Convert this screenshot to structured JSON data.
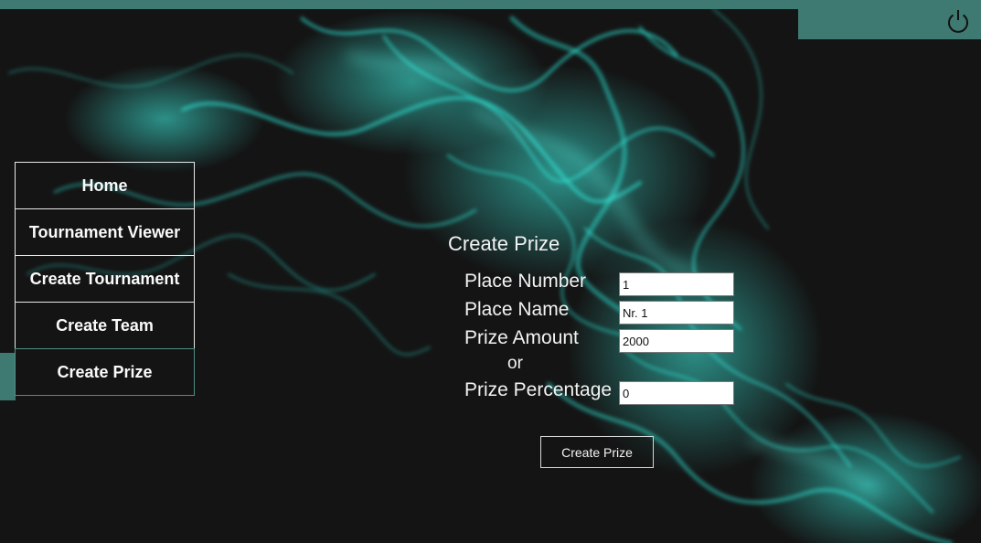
{
  "colors": {
    "accent": "#3f7a72",
    "smoke": "#2ee8d8",
    "background": "#141414"
  },
  "topbar": {
    "power_icon": "power-icon"
  },
  "nav": {
    "items": [
      {
        "label": "Home"
      },
      {
        "label": "Tournament Viewer"
      },
      {
        "label": "Create Tournament"
      },
      {
        "label": "Create Team"
      },
      {
        "label": "Create Prize",
        "active": true
      }
    ]
  },
  "form": {
    "title": "Create Prize",
    "place_number_label": "Place Number",
    "place_number_value": "1",
    "place_name_label": "Place Name",
    "place_name_value": "Nr. 1",
    "prize_amount_label": "Prize Amount",
    "prize_amount_value": "2000",
    "or_label": "or",
    "prize_percentage_label": "Prize Percentage",
    "prize_percentage_value": "0",
    "submit_label": "Create Prize"
  }
}
